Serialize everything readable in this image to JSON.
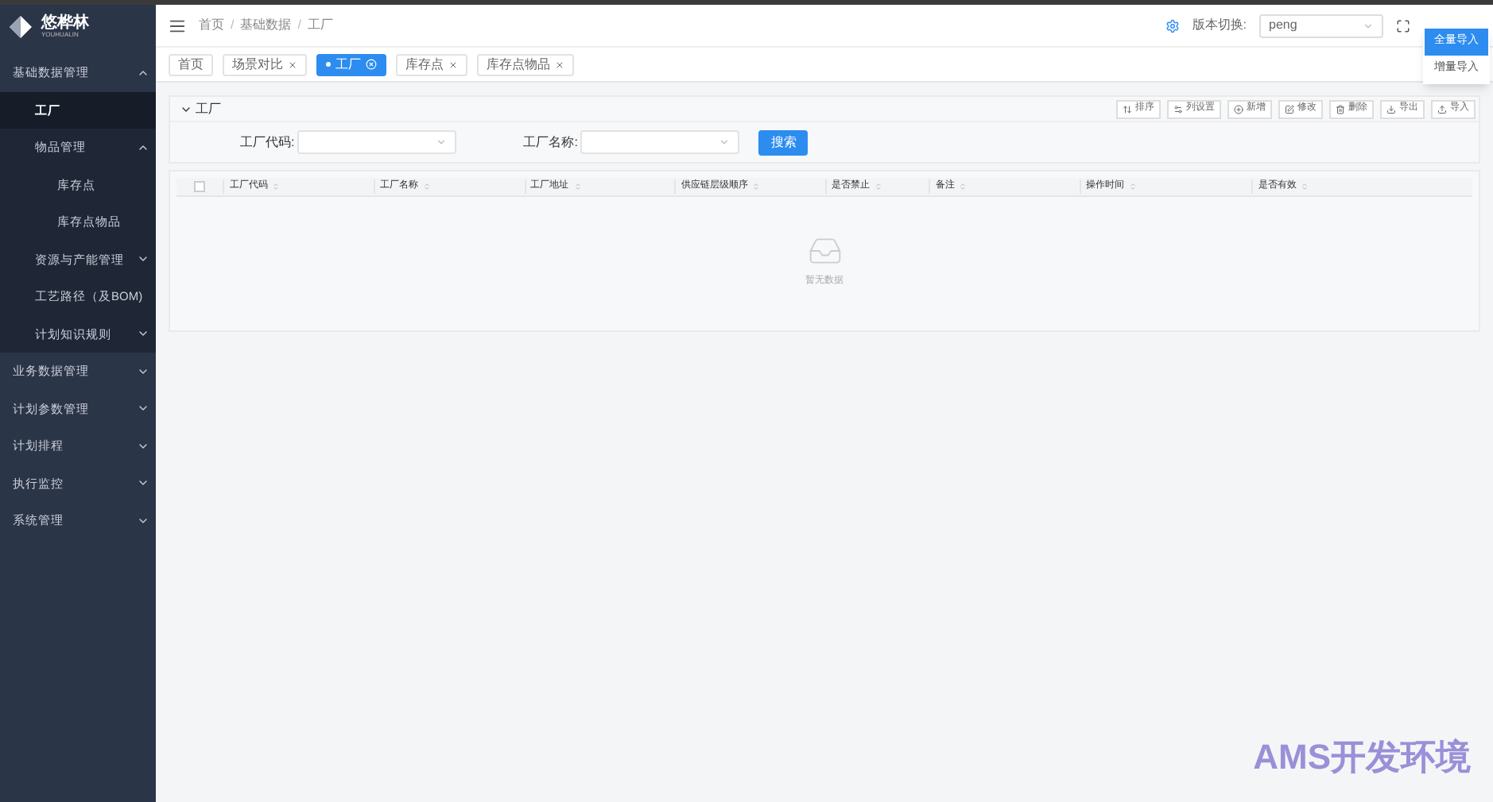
{
  "logo": {
    "name": "悠桦林",
    "subtitle": "YOUHUALIN"
  },
  "sidebar": {
    "items": [
      {
        "label": "基础数据管理",
        "expanded": true,
        "selected": false,
        "children": [
          {
            "label": "工厂",
            "selected": true
          },
          {
            "label": "物品管理",
            "expanded": true,
            "selected": false,
            "children": [
              {
                "label": "库存点",
                "selected": false
              },
              {
                "label": "库存点物品",
                "selected": false
              }
            ]
          },
          {
            "label": "资源与产能管理",
            "expanded": false,
            "selected": false
          },
          {
            "label": "工艺路径（及BOM)",
            "selected": false
          },
          {
            "label": "计划知识规则",
            "expanded": false,
            "selected": false
          }
        ]
      },
      {
        "label": "业务数据管理",
        "expanded": false,
        "selected": false
      },
      {
        "label": "计划参数管理",
        "expanded": false,
        "selected": false
      },
      {
        "label": "计划排程",
        "expanded": false,
        "selected": false
      },
      {
        "label": "执行监控",
        "expanded": false,
        "selected": false
      },
      {
        "label": "系统管理",
        "expanded": false,
        "selected": false
      }
    ]
  },
  "breadcrumb": [
    "首页",
    "基础数据",
    "工厂"
  ],
  "breadcrumb_separator": "/",
  "version": {
    "label": "版本切换:",
    "value": "peng"
  },
  "tabs": [
    {
      "label": "首页",
      "selected": false,
      "closable": false
    },
    {
      "label": "场景对比",
      "selected": false,
      "closable": true
    },
    {
      "label": "工厂",
      "selected": true,
      "closable": true
    },
    {
      "label": "库存点",
      "selected": false,
      "closable": true
    },
    {
      "label": "库存点物品",
      "selected": false,
      "closable": true
    }
  ],
  "panel": {
    "title": "工厂",
    "toolbar": [
      "排序",
      "列设置",
      "新增",
      "修改",
      "删除",
      "导出",
      "导入"
    ],
    "filters": [
      {
        "label": "工厂代码:"
      },
      {
        "label": "工厂名称:"
      }
    ],
    "search_button": "搜索"
  },
  "table": {
    "select_all_checked": false,
    "columns": [
      "工厂代码",
      "工厂名称",
      "工厂地址",
      "供应链层级顺序",
      "是否禁止",
      "备注",
      "操作时间",
      "是否有效"
    ],
    "empty_text": "暂无数据"
  },
  "import_menu": [
    {
      "label": "全量导入",
      "selected": true
    },
    {
      "label": "增量导入",
      "selected": false
    }
  ],
  "environment": "AMS开发环境"
}
